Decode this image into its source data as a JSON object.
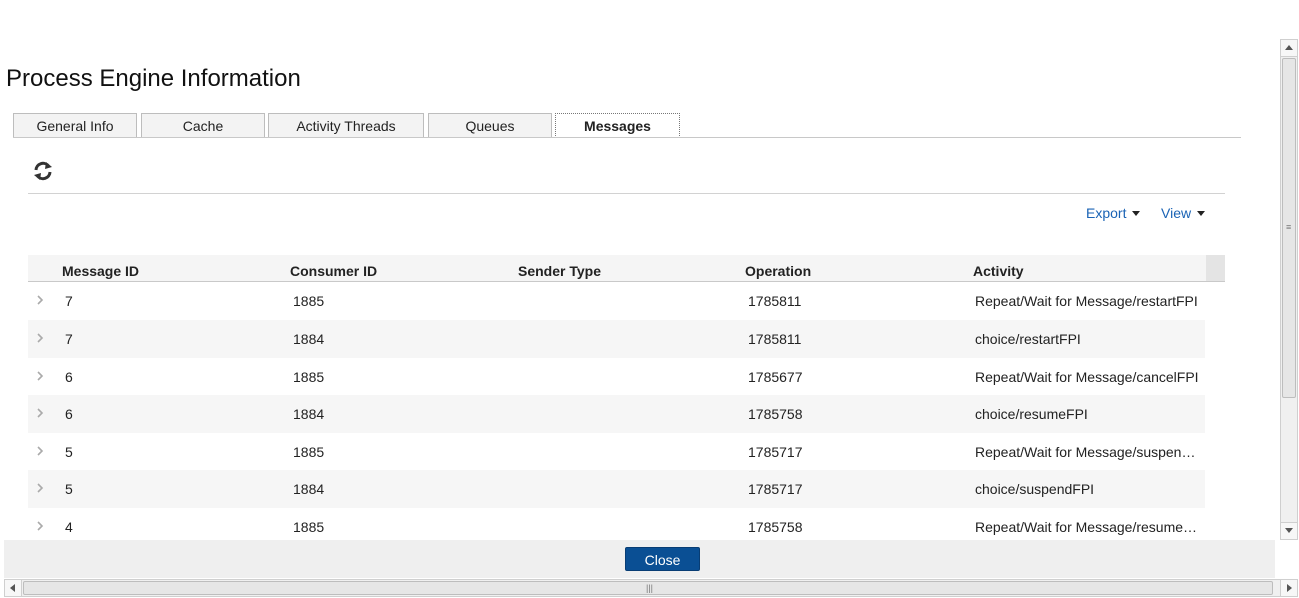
{
  "page": {
    "title": "Process Engine Information"
  },
  "tabs": [
    {
      "label": "General Info",
      "active": false
    },
    {
      "label": "Cache",
      "active": false
    },
    {
      "label": "Activity Threads",
      "active": false
    },
    {
      "label": "Queues",
      "active": false
    },
    {
      "label": "Messages",
      "active": true
    }
  ],
  "toolbar": {
    "refresh_icon": "refresh-icon",
    "export_label": "Export",
    "view_label": "View"
  },
  "table": {
    "columns": [
      "Message ID",
      "Consumer ID",
      "Sender Type",
      "Operation",
      "Activity"
    ],
    "rows": [
      {
        "message_id": "7",
        "consumer_id": "1885",
        "sender_type": "",
        "operation": "1785811",
        "activity": "Repeat/Wait for Message/restartFPI"
      },
      {
        "message_id": "7",
        "consumer_id": "1884",
        "sender_type": "",
        "operation": "1785811",
        "activity": "choice/restartFPI"
      },
      {
        "message_id": "6",
        "consumer_id": "1885",
        "sender_type": "",
        "operation": "1785677",
        "activity": "Repeat/Wait for Message/cancelFPI"
      },
      {
        "message_id": "6",
        "consumer_id": "1884",
        "sender_type": "",
        "operation": "1785758",
        "activity": "choice/resumeFPI"
      },
      {
        "message_id": "5",
        "consumer_id": "1885",
        "sender_type": "",
        "operation": "1785717",
        "activity": "Repeat/Wait for Message/suspendFPI"
      },
      {
        "message_id": "5",
        "consumer_id": "1884",
        "sender_type": "",
        "operation": "1785717",
        "activity": "choice/suspendFPI"
      },
      {
        "message_id": "4",
        "consumer_id": "1885",
        "sender_type": "",
        "operation": "1785758",
        "activity": "Repeat/Wait for Message/resumeFPI"
      }
    ]
  },
  "footer": {
    "close_label": "Close"
  },
  "colors": {
    "accent": "#1a63b5",
    "button": "#0a4f94",
    "row_alt": "#f6f6f6"
  }
}
